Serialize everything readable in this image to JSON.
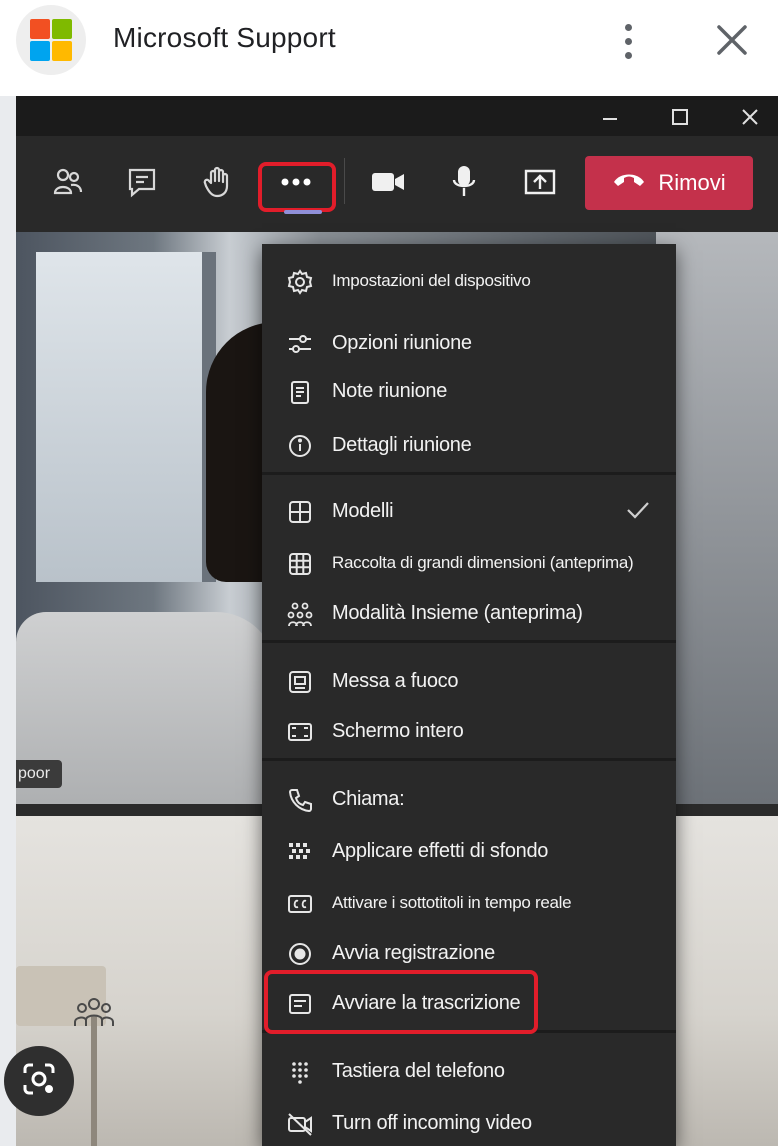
{
  "appbar": {
    "title": "Microsoft Support",
    "logo_colors": [
      "#f25022",
      "#7fba00",
      "#00a4ef",
      "#ffb900"
    ]
  },
  "toolbar": {
    "leave_label": "Rimovi",
    "leave_color": "#c4314b",
    "highlight_color": "#e11d2a"
  },
  "video": {
    "name_tag": "poor"
  },
  "menu": {
    "items": [
      {
        "label": "Impostazioni del dispositivo",
        "icon": "gear-icon"
      },
      {
        "label": "Opzioni riunione",
        "icon": "sliders-icon"
      },
      {
        "label": "Note riunione",
        "icon": "notes-icon"
      },
      {
        "label": "Dettagli riunione",
        "icon": "info-icon"
      },
      {
        "label": "Modelli",
        "icon": "layout-icon",
        "checked": true
      },
      {
        "label": "Raccolta di grandi dimensioni (anteprima)",
        "icon": "grid-icon"
      },
      {
        "label": "Modalità Insieme (anteprima)",
        "icon": "together-mode-icon"
      },
      {
        "label": "Messa a fuoco",
        "icon": "focus-icon"
      },
      {
        "label": "Schermo intero",
        "icon": "fullscreen-icon"
      },
      {
        "label": "Chiama:",
        "icon": "phone-icon"
      },
      {
        "label": "Applicare effetti di sfondo",
        "icon": "background-effects-icon"
      },
      {
        "label": "Attivare i sottotitoli in tempo reale",
        "icon": "captions-icon"
      },
      {
        "label": "Avvia registrazione",
        "icon": "record-icon"
      },
      {
        "label": "Avviare la trascrizione",
        "icon": "transcript-icon"
      },
      {
        "label": "Tastiera del telefono",
        "icon": "dialpad-icon"
      },
      {
        "label": "Turn off incoming video",
        "icon": "video-off-icon"
      }
    ]
  }
}
